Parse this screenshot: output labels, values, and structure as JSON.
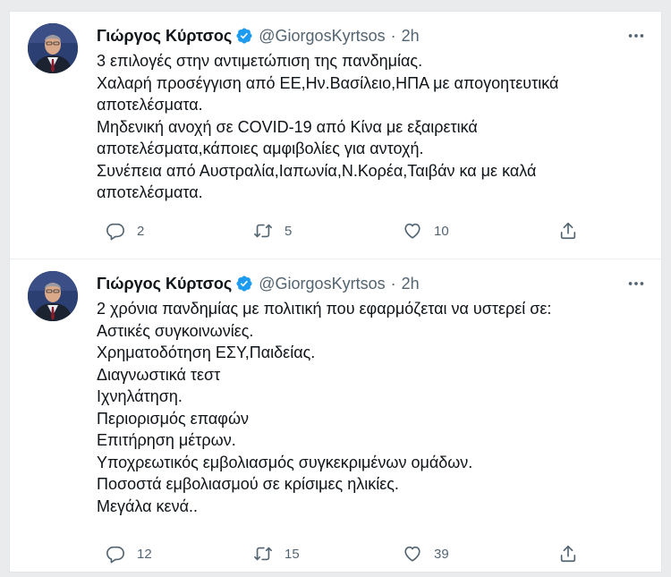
{
  "tweets": [
    {
      "author_name": "Γιώργος Κύρτσος",
      "handle": "@GiorgosKyrtsos",
      "separator": "·",
      "time": "2h",
      "lines": [
        "3 επιλογές στην αντιμετώπιση της πανδημίας.",
        "Χαλαρή προσέγγιση από ΕΕ,Ην.Βασίλειο,ΗΠΑ με απογοητευτικά",
        "αποτελέσματα.",
        "Μηδενική ανοχή σε COVID-19 από Κίνα με εξαιρετικά",
        "αποτελέσματα,κάποιες αμφιβολίες για αντοχή.",
        "Συνέπεια από Αυστραλία,Ιαπωνία,Ν.Κορέα,Ταιβάν κα με καλά",
        "αποτελέσματα."
      ],
      "replies": "2",
      "retweets": "5",
      "likes": "10"
    },
    {
      "author_name": "Γιώργος Κύρτσος",
      "handle": "@GiorgosKyrtsos",
      "separator": "·",
      "time": "2h",
      "lines": [
        "2 χρόνια πανδημίας με πολιτική που εφαρμόζεται να υστερεί σε:",
        "Αστικές συγκοινωνίες.",
        "Χρηματοδότηση ΕΣΥ,Παιδείας.",
        "Διαγνωστικά τεστ",
        "Ιχνηλάτηση.",
        "Περιορισμός επαφών",
        "Επιτήρηση μέτρων.",
        "Υποχρεωτικός εμβολιασμός συγκεκριμένων ομάδων.",
        "Ποσοστά εμβολιασμού σε κρίσιμες ηλικίες.",
        "Μεγάλα κενά.."
      ],
      "replies": "12",
      "retweets": "15",
      "likes": "39"
    }
  ],
  "icons": {
    "verified": "verified-badge-icon",
    "more": "more-options-icon",
    "reply": "reply-icon",
    "retweet": "retweet-icon",
    "like": "like-heart-icon",
    "share": "share-icon"
  },
  "colors": {
    "verified_blue": "#1d9bf0",
    "text_primary": "#0f1419",
    "text_secondary": "#536471"
  }
}
